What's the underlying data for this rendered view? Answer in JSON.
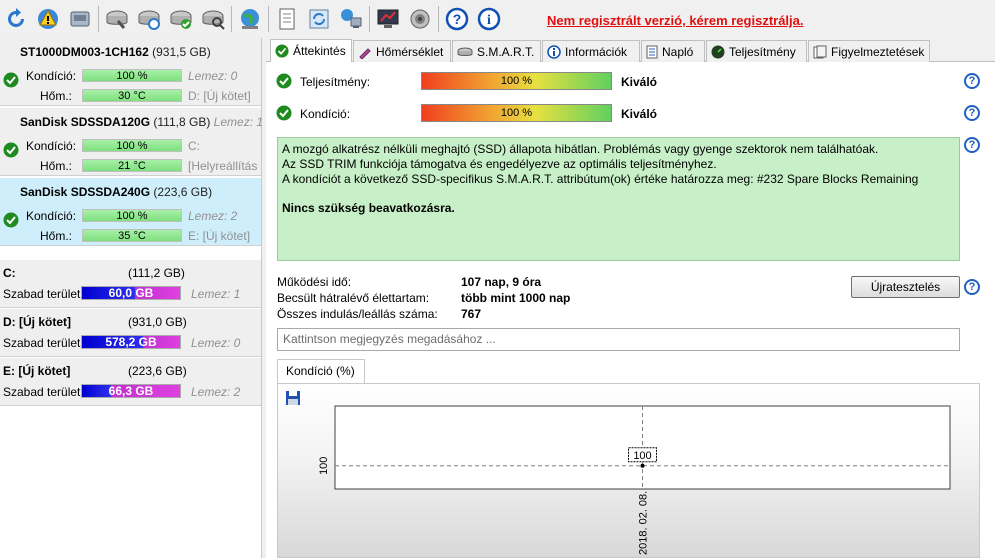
{
  "toolbar": {
    "buttons": [
      {
        "icon": "refresh-icon"
      },
      {
        "icon": "warning-icon"
      },
      {
        "icon": "drive-icon"
      },
      {
        "icon": "disk-tools-icon"
      },
      {
        "icon": "disk-refresh-icon"
      },
      {
        "icon": "disk-check-icon"
      },
      {
        "icon": "disk-search-icon"
      },
      {
        "icon": "globe-icon"
      },
      {
        "icon": "document-icon"
      },
      {
        "icon": "sync-icon"
      },
      {
        "icon": "network-icon"
      },
      {
        "icon": "monitor-icon"
      },
      {
        "icon": "speaker-icon"
      },
      {
        "icon": "help-icon"
      },
      {
        "icon": "info-icon"
      }
    ],
    "unregistered": "Nem regisztrált verzió, kérem regisztrálja."
  },
  "disks": [
    {
      "name": "ST1000DM003-1CH162",
      "capacity": "(931,5 GB)",
      "lezez": "",
      "kondicio_label": "Kondíció:",
      "kondicio": "100 %",
      "kondicio_side": "Lemez: 0",
      "hom_label": "Hőm.:",
      "hom": "30 °C",
      "hom_side": "D: [Új kötet]"
    },
    {
      "name": "SanDisk SDSSDA120G",
      "capacity": "(111,8 GB)",
      "lezez": "Lemez: 1",
      "kondicio_label": "Kondíció:",
      "kondicio": "100 %",
      "kondicio_side": "C:",
      "hom_label": "Hőm.:",
      "hom": "21 °C",
      "hom_side": "[Helyreállítás"
    },
    {
      "name": "SanDisk SDSSDA240G",
      "capacity": "(223,6 GB)",
      "lezez": "",
      "kondicio_label": "Kondíció:",
      "kondicio": "100 %",
      "kondicio_side": "Lemez: 2",
      "hom_label": "Hőm.:",
      "hom": "35 °C",
      "hom_side": "E: [Új kötet]"
    }
  ],
  "volumes": [
    {
      "name": "C:",
      "size": "(111,2 GB)",
      "free_label": "Szabad terület",
      "free": "60,0 GB",
      "free_fraction": 0.54,
      "disk": "Lemez: 1"
    },
    {
      "name": "D: [Új kötet]",
      "size": "(931,0 GB)",
      "free_label": "Szabad terület",
      "free": "578,2 GB",
      "free_fraction": 0.62,
      "disk": "Lemez: 0"
    },
    {
      "name": "E: [Új kötet]",
      "size": "(223,6 GB)",
      "free_label": "Szabad terület",
      "free": "66,3 GB",
      "free_fraction": 0.3,
      "disk": "Lemez: 2"
    }
  ],
  "tabs": [
    {
      "label": "Áttekintés",
      "icon": "check-icon"
    },
    {
      "label": "Hőmérséklet",
      "icon": "thermometer-icon"
    },
    {
      "label": "S.M.A.R.T.",
      "icon": "smart-icon"
    },
    {
      "label": "Információk",
      "icon": "info-icon"
    },
    {
      "label": "Napló",
      "icon": "log-icon"
    },
    {
      "label": "Teljesítmény",
      "icon": "gauge-icon"
    },
    {
      "label": "Figyelmeztetések",
      "icon": "alerts-icon"
    }
  ],
  "overview": {
    "perf_label": "Teljesítmény:",
    "perf_value": "100 %",
    "perf_rating": "Kiváló",
    "cond_label": "Kondíció:",
    "cond_value": "100 %",
    "cond_rating": "Kiváló",
    "info_lines": [
      "A mozgó alkatrész nélküli meghajtó (SSD) állapota hibátlan. Problémás vagy gyenge szektorok nem találhatóak.",
      "Az SSD TRIM funkciója támogatva és engedélyezve az optimális teljesítményhez.",
      "A kondíciót a következő SSD-specifikus S.M.A.R.T. attribútum(ok) értéke határozza meg:  #232 Spare Blocks Remaining"
    ],
    "info_strong": "Nincs szükség beavatkozásra.",
    "stats": [
      {
        "label": "Működési idő:",
        "value": "107 nap, 9 óra"
      },
      {
        "label": "Becsült hátralévő élettartam:",
        "value": "több mint 1000 nap"
      },
      {
        "label": "Összes indulás/leállás száma:",
        "value": "767"
      }
    ],
    "retest_label": "Újratesztelés",
    "note_placeholder": "Kattintson megjegyzés megadásához ...",
    "chart_tab": "Kondíció  (%)"
  },
  "chart_data": {
    "type": "line",
    "title": "",
    "xlabel": "",
    "ylabel": "",
    "x": [
      "2018. 02. 08."
    ],
    "series": [
      {
        "values": [
          100
        ]
      }
    ],
    "y_tick_labels": [
      "100"
    ],
    "data_labels": [
      "100"
    ],
    "grid": true
  }
}
